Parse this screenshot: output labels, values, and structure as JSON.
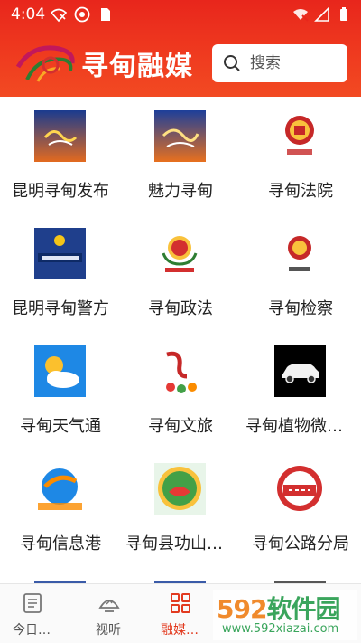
{
  "status_bar": {
    "time": "4:04"
  },
  "header": {
    "brand_title": "寻甸融媒",
    "search": {
      "placeholder": "搜索",
      "value": ""
    }
  },
  "colors": {
    "brand_red": "#ef3a1f",
    "active_nav": "#e23a1f"
  },
  "grid": {
    "tiles": [
      {
        "label": "昆明寻甸发布",
        "icon": "xundian-release-logo"
      },
      {
        "label": "魅力寻甸",
        "icon": "charm-xundian-logo"
      },
      {
        "label": "寻甸法院",
        "icon": "court-emblem"
      },
      {
        "label": "昆明寻甸警方",
        "icon": "police-logo"
      },
      {
        "label": "寻甸政法",
        "icon": "politics-law-emblem"
      },
      {
        "label": "寻甸检察",
        "icon": "procuratorate-emblem"
      },
      {
        "label": "寻甸天气通",
        "icon": "weather-icon"
      },
      {
        "label": "寻甸文旅",
        "icon": "culture-tourism-logo"
      },
      {
        "label": "寻甸植物微景…",
        "icon": "car-icon"
      },
      {
        "label": "寻甸信息港",
        "icon": "info-port-logo"
      },
      {
        "label": "寻甸县功山镇…",
        "icon": "gongshan-town-logo"
      },
      {
        "label": "寻甸公路分局",
        "icon": "highway-bureau-logo"
      }
    ]
  },
  "bottom_nav": {
    "items": [
      {
        "label": "今日…",
        "icon": "news-icon",
        "active": false
      },
      {
        "label": "视听",
        "icon": "tv-icon",
        "active": false
      },
      {
        "label": "融媒…",
        "icon": "grid-icon",
        "active": true
      }
    ]
  },
  "watermark": {
    "big_num": "592",
    "big_cn": "软件园",
    "small": "www.592xiazai.com"
  }
}
